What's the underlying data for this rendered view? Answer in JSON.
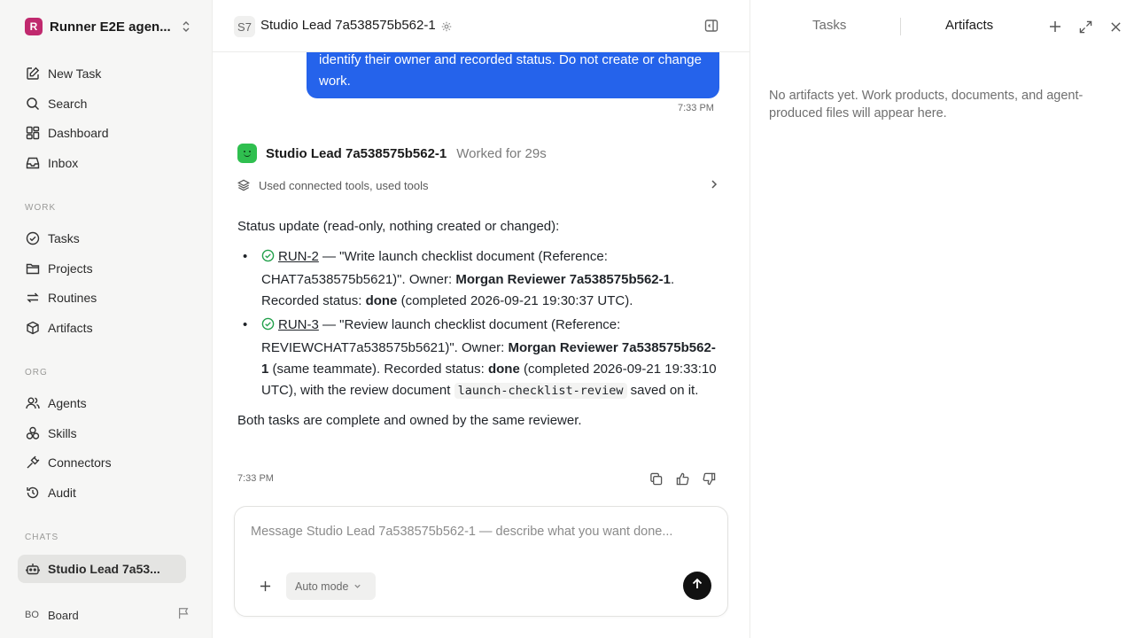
{
  "workspace": {
    "logo": "R",
    "name": "Runner E2E agen..."
  },
  "nav": {
    "new_task": "New Task",
    "search": "Search",
    "dashboard": "Dashboard",
    "inbox": "Inbox"
  },
  "sections": {
    "work": "WORK",
    "org": "ORG",
    "chats": "CHATS"
  },
  "work_items": {
    "tasks": "Tasks",
    "projects": "Projects",
    "routines": "Routines",
    "artifacts": "Artifacts"
  },
  "org_items": {
    "agents": "Agents",
    "skills": "Skills",
    "connectors": "Connectors",
    "audit": "Audit"
  },
  "chats": {
    "active": "Studio Lead 7a53..."
  },
  "user": {
    "initials": "BO",
    "name": "Board"
  },
  "chat": {
    "abbr": "S7",
    "title": "Studio Lead 7a538575b562-1",
    "user_message": "identify their owner and recorded status. Do not create or change work.",
    "user_time": "7:33 PM",
    "agent_name": "Studio Lead 7a538575b562-1",
    "worked": "Worked for 29s",
    "tools_summary": "Used connected tools, used tools",
    "intro": "Status update (read-only, nothing created or changed):",
    "items": [
      {
        "id": "RUN-2",
        "text_a": " — \"Write launch checklist document (Reference: CHAT7a538575b5621)\". Owner: ",
        "owner": "Morgan Reviewer 7a538575b562-1",
        "text_b": ". Recorded status: ",
        "status": "done",
        "text_c": " (completed 2026-09-21 19:30:37 UTC)."
      },
      {
        "id": "RUN-3",
        "text_a": " — \"Review launch checklist document (Reference: REVIEWCHAT7a538575b5621)\". Owner: ",
        "owner": "Morgan Reviewer 7a538575b562-1",
        "text_b": " (same teammate). Recorded status: ",
        "status": "done",
        "text_c": " (completed 2026-09-21 19:33:10 UTC), with the review document ",
        "doc": "launch-checklist-review",
        "text_d": " saved on it."
      }
    ],
    "conclusion": "Both tasks are complete and owned by the same reviewer.",
    "agent_time": "7:33 PM"
  },
  "composer": {
    "placeholder": "Message Studio Lead 7a538575b562-1 — describe what you want done...",
    "mode": "Auto mode"
  },
  "right_panel": {
    "tab_tasks": "Tasks",
    "tab_artifacts": "Artifacts",
    "empty_text": "No artifacts yet. Work products, documents, and agent-produced files will appear here."
  },
  "colors": {
    "accent": "#2563eb",
    "workspace_logo": "#c0296e",
    "avatar": "#2fbf4f",
    "done_check": "#22a04b"
  },
  "icons": [
    "edit-icon",
    "search-icon",
    "dashboard-icon",
    "inbox-icon",
    "check-circle-icon",
    "folder-icon",
    "routine-icon",
    "cube-icon",
    "people-icon",
    "skills-icon",
    "plug-icon",
    "history-icon",
    "robot-icon",
    "flag-icon",
    "gear-icon",
    "panel-toggle-icon",
    "layers-icon",
    "chevron-right-icon",
    "copy-icon",
    "thumbs-up-icon",
    "thumbs-down-icon",
    "plus-icon",
    "chevron-down-icon",
    "arrow-up-icon",
    "expand-icon",
    "close-icon"
  ]
}
